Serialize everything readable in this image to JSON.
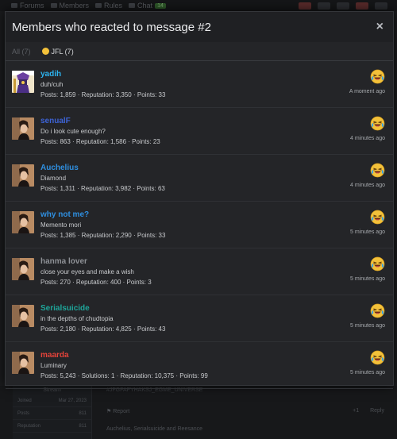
{
  "background": {
    "nav": [
      {
        "label": "Forums"
      },
      {
        "label": "Members"
      },
      {
        "label": "Rules"
      },
      {
        "label": "Chat",
        "count": "14"
      }
    ],
    "sidebar_head": "Stream",
    "sidebar_rows": [
      {
        "label": "Joined",
        "value": "Mar 27, 2023"
      },
      {
        "label": "Posts",
        "value": "811"
      },
      {
        "label": "Reputation",
        "value": "811"
      }
    ],
    "signature": "#JFGFAFYHAKSJ_EGME_UNIVERSE",
    "report": "Report",
    "actions": [
      "+1",
      "Reply"
    ],
    "reacted": "Auchelius, Serialsuicide and Reesance"
  },
  "modal": {
    "title": "Members who reacted to message #2",
    "close_label": "×",
    "tabs": [
      {
        "label": "All (7)"
      },
      {
        "label": "JFL (7)"
      }
    ],
    "members": [
      {
        "name": "yadih",
        "name_color": "#2db4f0",
        "title": "duh/cuh",
        "stats": "Posts: 1,859 · Reputation: 3,350 · Points: 33",
        "time": "A moment ago",
        "avatar": "mage"
      },
      {
        "name": "senualF",
        "name_color": "#3d63d6",
        "title": "Do i look cute enough?",
        "stats": "Posts: 863 · Reputation: 1,586 · Points: 23",
        "time": "4 minutes ago",
        "avatar": "person"
      },
      {
        "name": "Auchelius",
        "name_color": "#2f8fe0",
        "title": "Diamond",
        "stats": "Posts: 1,311 · Reputation: 3,982 · Points: 63",
        "time": "4 minutes ago",
        "avatar": "person"
      },
      {
        "name": "why not me?",
        "name_color": "#2f8fe0",
        "title": "Memento mori",
        "stats": "Posts: 1,385 · Reputation: 2,290 · Points: 33",
        "time": "5 minutes ago",
        "avatar": "person"
      },
      {
        "name": "hanma lover",
        "name_color": "#8e9196",
        "title": "close your eyes and make a wish",
        "stats": "Posts: 270 · Reputation: 400 · Points: 3",
        "time": "5 minutes ago",
        "avatar": "person"
      },
      {
        "name": "Serialsuicide",
        "name_color": "#1ea69a",
        "title": "in the depths of chudtopia",
        "stats": "Posts: 2,180 · Reputation: 4,825 · Points: 43",
        "time": "5 minutes ago",
        "avatar": "person"
      },
      {
        "name": "maarda",
        "name_color": "#e5433a",
        "title": "Luminary",
        "stats": "Posts: 5,243 · Solutions: 1 · Reputation: 10,375 · Points: 99",
        "time": "5 minutes ago",
        "avatar": "person"
      }
    ]
  },
  "colors": {
    "modal_bg": "#242528",
    "header_bg": "#1f2023",
    "reaction_yellow": "#f3c13a",
    "tear_blue": "#3aa3e8"
  },
  "icons": {
    "close": "close-icon",
    "reaction": "laughing-crying-emoji-icon"
  }
}
